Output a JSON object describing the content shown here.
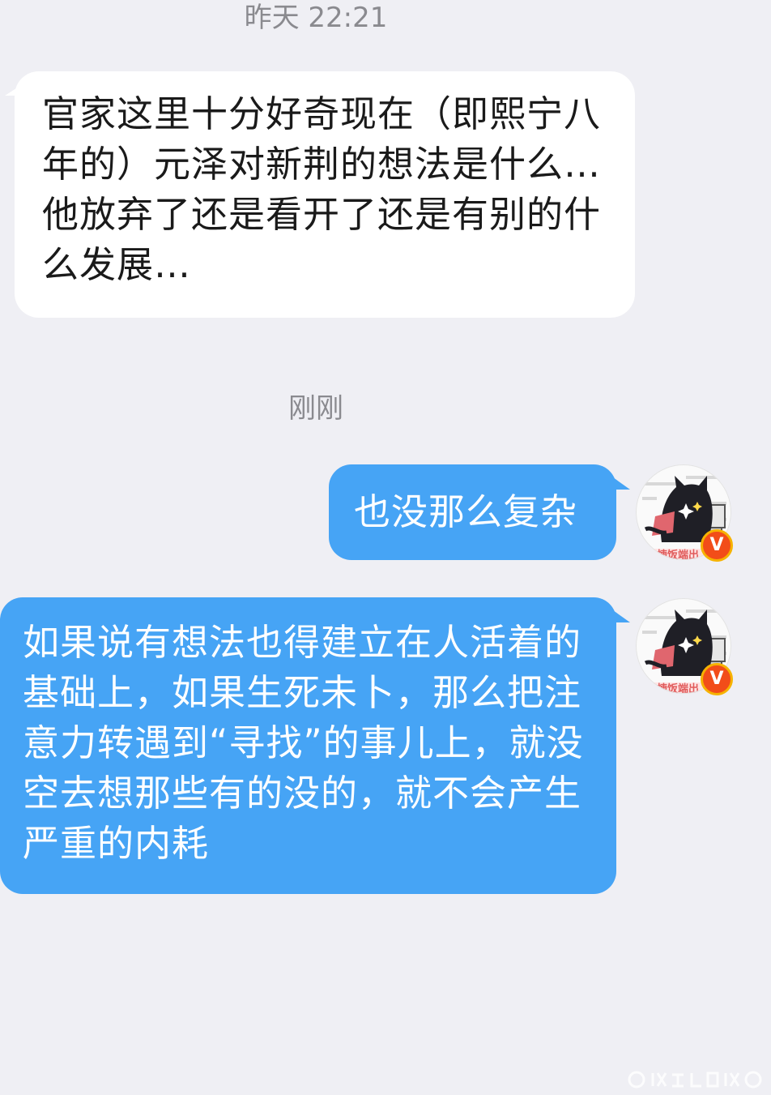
{
  "timestamps": {
    "first": "昨天 22:21",
    "second": "刚刚"
  },
  "messages": [
    {
      "direction": "incoming",
      "text": "官家这里十分好奇现在（即熙宁八年的）元泽对新荆的想法是什么…他放弃了还是看开了还是有别的什么发展…"
    },
    {
      "direction": "outgoing",
      "text": "也没那么复杂"
    },
    {
      "direction": "outgoing",
      "text": "如果说有想法也得建立在人活着的基础上，如果生死未卜，那么把注意力转遇到“寻找”的事儿上，就没空去想那些有的没的，就不会产生严重的内耗"
    }
  ],
  "avatar": {
    "icon": "black-cat-avatar-icon",
    "verified_badge": "V",
    "badge_color": "#f24d19"
  },
  "colors": {
    "background": "#efeff4",
    "incoming_bubble": "#ffffff",
    "outgoing_bubble": "#46a4f5",
    "timestamp_text": "#8a8a8f"
  }
}
